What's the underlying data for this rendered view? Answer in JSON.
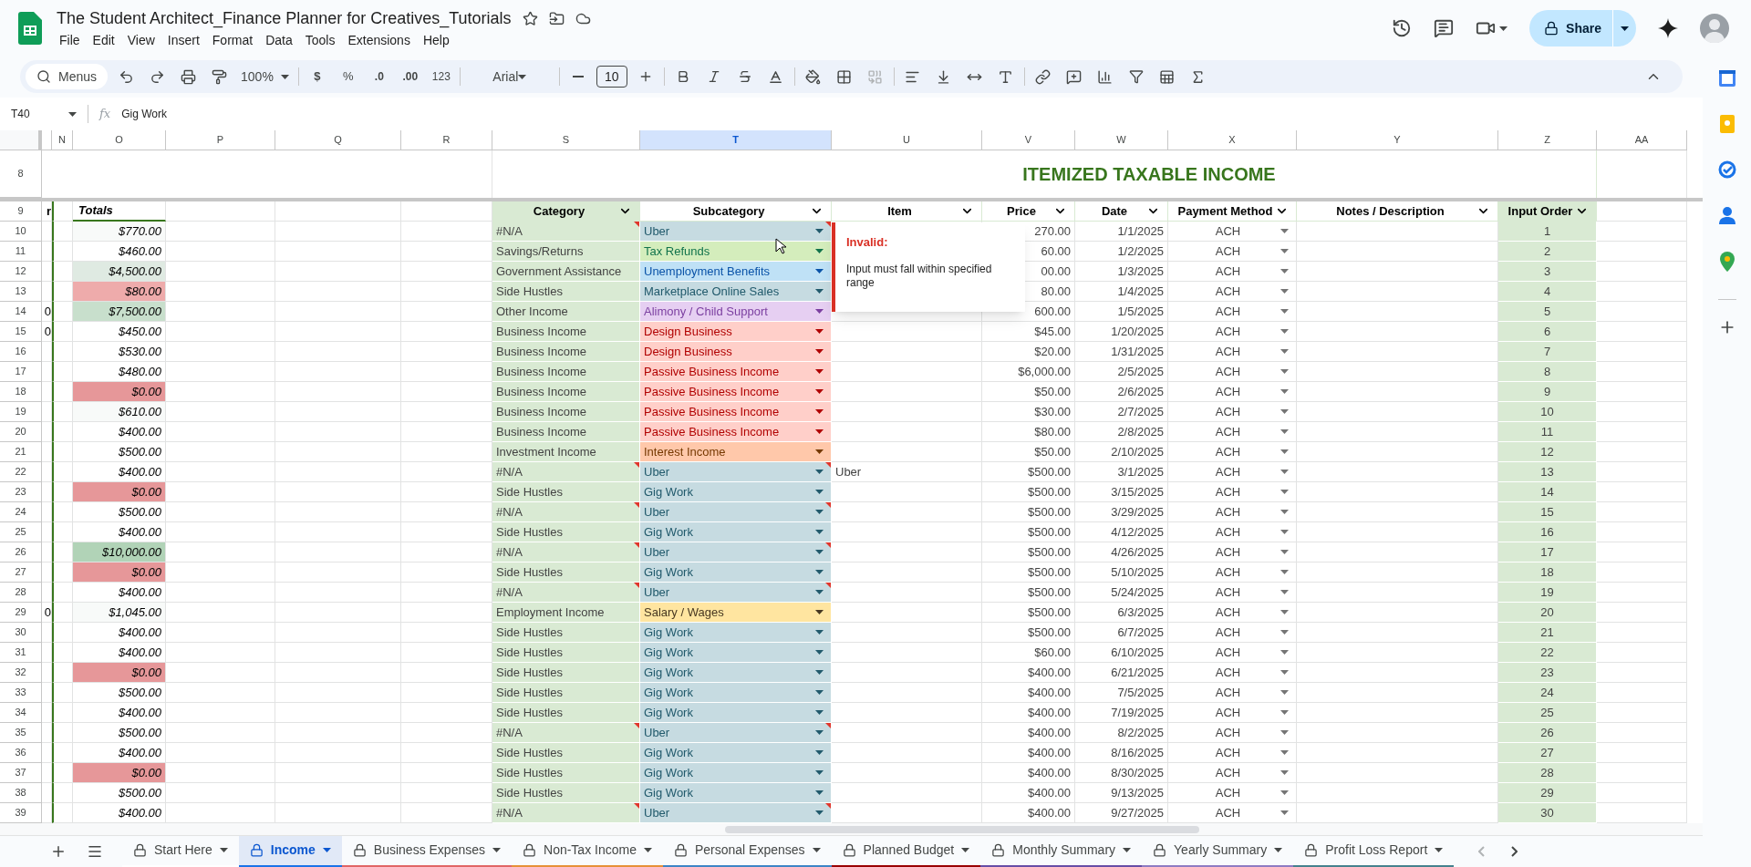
{
  "document": {
    "title": "The Student Architect_Finance Planner for Creatives_Tutorials",
    "menus": [
      "File",
      "Edit",
      "View",
      "Insert",
      "Format",
      "Data",
      "Tools",
      "Extensions",
      "Help"
    ],
    "share": "Share"
  },
  "toolbar": {
    "search": "Menus",
    "zoom": "100%",
    "currency": "$",
    "percent": "%",
    "decrease_decimals": ".0",
    "increase_decimals": ".00",
    "number_format": "123",
    "font": "Arial",
    "font_size": "10"
  },
  "formula_bar": {
    "cell": "T40",
    "fx_label": "fx",
    "value": "Gig Work"
  },
  "columns": [
    {
      "label": "N",
      "selected": false
    },
    {
      "label": "O",
      "selected": false
    },
    {
      "label": "P",
      "selected": false
    },
    {
      "label": "Q",
      "selected": false
    },
    {
      "label": "R",
      "selected": false
    },
    {
      "label": "S",
      "selected": false
    },
    {
      "label": "T",
      "selected": true
    },
    {
      "label": "U",
      "selected": false
    },
    {
      "label": "V",
      "selected": false
    },
    {
      "label": "W",
      "selected": false
    },
    {
      "label": "X",
      "selected": false
    },
    {
      "label": "Y",
      "selected": false
    },
    {
      "label": "Z",
      "selected": false
    },
    {
      "label": "AA",
      "selected": false
    }
  ],
  "title_row": {
    "number": "8",
    "title": "ITEMIZED TAXABLE INCOME"
  },
  "header_row": {
    "number": "9",
    "spill": "r",
    "totals_label": "Totals",
    "headers": [
      {
        "label": "Category",
        "shaded": true
      },
      {
        "label": "Subcategory",
        "shaded": false
      },
      {
        "label": "Item",
        "shaded": false
      },
      {
        "label": "Price",
        "shaded": false
      },
      {
        "label": "Date",
        "shaded": false
      },
      {
        "label": "Payment Method",
        "shaded": false
      },
      {
        "label": "Notes / Description",
        "shaded": false
      },
      {
        "label": "Input Order",
        "shaded": true
      }
    ]
  },
  "rows": [
    {
      "number": "10",
      "total": {
        "text": "$770.00",
        "color": "#f8faf9"
      },
      "category": "#N/A",
      "invalid": true,
      "subcategory": {
        "color": "#c6dbe1",
        "label": {
          "text": "Uber",
          "color": "#215a6c"
        }
      },
      "price": "270.00",
      "date": "1/1/2025",
      "payment": "ACH",
      "order": "1"
    },
    {
      "number": "11",
      "total": {
        "text": "$460.00"
      },
      "category": "Savings/Returns",
      "invalid": false,
      "subcategory": {
        "color": "#d4edbc",
        "label": {
          "text": "Tax Refunds",
          "color": "#11734b"
        }
      },
      "price": "60.00",
      "date": "1/2/2025",
      "payment": "ACH",
      "order": "2"
    },
    {
      "number": "12",
      "total": {
        "text": "$4,500.00",
        "color": "#dfeae2"
      },
      "category": "Government Assistance",
      "invalid": false,
      "subcategory": {
        "color": "#bfe1f6",
        "label": {
          "text": "Unemployment Benefits",
          "color": "#0a53a8"
        }
      },
      "price": "00.00",
      "date": "1/3/2025",
      "payment": "ACH",
      "order": "3"
    },
    {
      "number": "13",
      "total": {
        "text": "$80.00",
        "color": "#eeabab"
      },
      "category": "Side Hustles",
      "invalid": false,
      "subcategory": {
        "color": "#c6dbe1",
        "label": {
          "text": "Marketplace Online Sales",
          "color": "#215a6c"
        }
      },
      "price": "80.00",
      "date": "1/4/2025",
      "payment": "ACH",
      "order": "4"
    },
    {
      "number": "14",
      "spill": "0",
      "total": {
        "text": "$7,500.00",
        "color": "#c8dfcc"
      },
      "category": "Other Income",
      "invalid": false,
      "subcategory": {
        "color": "#e6cff2",
        "label": {
          "text": "Alimony / Child Support",
          "color": "#7b3fa0"
        }
      },
      "price": "600.00",
      "date": "1/5/2025",
      "payment": "ACH",
      "order": "5"
    },
    {
      "number": "15",
      "spill": "0",
      "total": {
        "text": "$450.00"
      },
      "category": "Business Income",
      "invalid": false,
      "subcategory": {
        "color": "#ffcfc9",
        "label": {
          "text": "Design Business",
          "color": "#b10202"
        }
      },
      "price": "$45.00",
      "date": "1/20/2025",
      "payment": "ACH",
      "order": "6"
    },
    {
      "number": "16",
      "total": {
        "text": "$530.00"
      },
      "category": "Business Income",
      "invalid": false,
      "subcategory": {
        "color": "#ffcfc9",
        "label": {
          "text": "Design Business",
          "color": "#b10202"
        }
      },
      "price": "$20.00",
      "date": "1/31/2025",
      "payment": "ACH",
      "order": "7"
    },
    {
      "number": "17",
      "total": {
        "text": "$480.00"
      },
      "category": "Business Income",
      "invalid": false,
      "subcategory": {
        "color": "#ffcfc9",
        "label": {
          "text": "Passive Business Income",
          "color": "#b10202"
        }
      },
      "price": "$6,000.00",
      "date": "2/5/2025",
      "payment": "ACH",
      "order": "8"
    },
    {
      "number": "18",
      "total": {
        "text": "$0.00",
        "color": "#e69799"
      },
      "category": "Business Income",
      "invalid": false,
      "subcategory": {
        "color": "#ffcfc9",
        "label": {
          "text": "Passive Business Income",
          "color": "#b10202"
        }
      },
      "price": "$50.00",
      "date": "2/6/2025",
      "payment": "ACH",
      "order": "9"
    },
    {
      "number": "19",
      "total": {
        "text": "$610.00",
        "color": "#f8faf9"
      },
      "category": "Business Income",
      "invalid": false,
      "subcategory": {
        "color": "#ffcfc9",
        "label": {
          "text": "Passive Business Income",
          "color": "#b10202"
        }
      },
      "price": "$30.00",
      "date": "2/7/2025",
      "payment": "ACH",
      "order": "10"
    },
    {
      "number": "20",
      "total": {
        "text": "$400.00"
      },
      "category": "Business Income",
      "invalid": false,
      "subcategory": {
        "color": "#ffcfc9",
        "label": {
          "text": "Passive Business Income",
          "color": "#b10202"
        }
      },
      "price": "$80.00",
      "date": "2/8/2025",
      "payment": "ACH",
      "order": "11"
    },
    {
      "number": "21",
      "total": {
        "text": "$500.00"
      },
      "category": "Investment Income",
      "invalid": false,
      "subcategory": {
        "color": "#ffc8aa",
        "label": {
          "text": "Interest Income",
          "color": "#753800"
        }
      },
      "price": "$50.00",
      "date": "2/10/2025",
      "payment": "ACH",
      "order": "12"
    },
    {
      "number": "22",
      "total": {
        "text": "$400.00"
      },
      "category": "#N/A",
      "invalid": true,
      "subcategory": {
        "color": "#c6dbe1",
        "label": {
          "text": "Uber",
          "color": "#215a6c"
        }
      },
      "item": "Uber",
      "price": "$500.00",
      "date": "3/1/2025",
      "payment": "ACH",
      "order": "13"
    },
    {
      "number": "23",
      "total": {
        "text": "$0.00",
        "color": "#e69799"
      },
      "category": "Side Hustles",
      "invalid": false,
      "subcategory": {
        "color": "#c6dbe1",
        "label": {
          "text": "Gig Work",
          "color": "#215a6c"
        }
      },
      "price": "$500.00",
      "date": "3/15/2025",
      "payment": "ACH",
      "order": "14"
    },
    {
      "number": "24",
      "total": {
        "text": "$500.00"
      },
      "category": "#N/A",
      "invalid": true,
      "subcategory": {
        "color": "#c6dbe1",
        "label": {
          "text": "Uber",
          "color": "#215a6c"
        }
      },
      "price": "$500.00",
      "date": "3/29/2025",
      "payment": "ACH",
      "order": "15"
    },
    {
      "number": "25",
      "total": {
        "text": "$400.00"
      },
      "category": "Side Hustles",
      "invalid": false,
      "subcategory": {
        "color": "#c6dbe1",
        "label": {
          "text": "Gig Work",
          "color": "#215a6c"
        }
      },
      "price": "$500.00",
      "date": "4/12/2025",
      "payment": "ACH",
      "order": "16"
    },
    {
      "number": "26",
      "total": {
        "text": "$10,000.00",
        "color": "#b1d3b7"
      },
      "category": "#N/A",
      "invalid": true,
      "subcategory": {
        "color": "#c6dbe1",
        "label": {
          "text": "Uber",
          "color": "#215a6c"
        }
      },
      "price": "$500.00",
      "date": "4/26/2025",
      "payment": "ACH",
      "order": "17"
    },
    {
      "number": "27",
      "total": {
        "text": "$0.00",
        "color": "#e69799"
      },
      "category": "Side Hustles",
      "invalid": false,
      "subcategory": {
        "color": "#c6dbe1",
        "label": {
          "text": "Gig Work",
          "color": "#215a6c"
        }
      },
      "price": "$500.00",
      "date": "5/10/2025",
      "payment": "ACH",
      "order": "18"
    },
    {
      "number": "28",
      "total": {
        "text": "$400.00"
      },
      "category": "#N/A",
      "invalid": true,
      "subcategory": {
        "color": "#c6dbe1",
        "label": {
          "text": "Uber",
          "color": "#215a6c"
        }
      },
      "price": "$500.00",
      "date": "5/24/2025",
      "payment": "ACH",
      "order": "19"
    },
    {
      "number": "29",
      "spill": "0",
      "total": {
        "text": "$1,045.00",
        "color": "#f8faf9"
      },
      "category": "Employment Income",
      "invalid": false,
      "subcategory": {
        "color": "#ffe5a0",
        "label": {
          "text": "Salary / Wages",
          "color": "#473821"
        }
      },
      "price": "$500.00",
      "date": "6/3/2025",
      "payment": "ACH",
      "order": "20"
    },
    {
      "number": "30",
      "total": {
        "text": "$400.00"
      },
      "category": "Side Hustles",
      "invalid": false,
      "subcategory": {
        "color": "#c6dbe1",
        "label": {
          "text": "Gig Work",
          "color": "#215a6c"
        }
      },
      "price": "$500.00",
      "date": "6/7/2025",
      "payment": "ACH",
      "order": "21"
    },
    {
      "number": "31",
      "total": {
        "text": "$400.00"
      },
      "category": "Side Hustles",
      "invalid": false,
      "subcategory": {
        "color": "#c6dbe1",
        "label": {
          "text": "Gig Work",
          "color": "#215a6c"
        }
      },
      "price": "$60.00",
      "date": "6/10/2025",
      "payment": "ACH",
      "order": "22"
    },
    {
      "number": "32",
      "total": {
        "text": "$0.00",
        "color": "#e69799"
      },
      "category": "Side Hustles",
      "invalid": false,
      "subcategory": {
        "color": "#c6dbe1",
        "label": {
          "text": "Gig Work",
          "color": "#215a6c"
        }
      },
      "price": "$400.00",
      "date": "6/21/2025",
      "payment": "ACH",
      "order": "23"
    },
    {
      "number": "33",
      "total": {
        "text": "$500.00"
      },
      "category": "Side Hustles",
      "invalid": false,
      "subcategory": {
        "color": "#c6dbe1",
        "label": {
          "text": "Gig Work",
          "color": "#215a6c"
        }
      },
      "price": "$400.00",
      "date": "7/5/2025",
      "payment": "ACH",
      "order": "24"
    },
    {
      "number": "34",
      "total": {
        "text": "$400.00"
      },
      "category": "Side Hustles",
      "invalid": false,
      "subcategory": {
        "color": "#c6dbe1",
        "label": {
          "text": "Gig Work",
          "color": "#215a6c"
        }
      },
      "price": "$400.00",
      "date": "7/19/2025",
      "payment": "ACH",
      "order": "25"
    },
    {
      "number": "35",
      "total": {
        "text": "$500.00"
      },
      "category": "#N/A",
      "invalid": true,
      "subcategory": {
        "color": "#c6dbe1",
        "label": {
          "text": "Uber",
          "color": "#215a6c"
        }
      },
      "price": "$400.00",
      "date": "8/2/2025",
      "payment": "ACH",
      "order": "26"
    },
    {
      "number": "36",
      "total": {
        "text": "$400.00"
      },
      "category": "Side Hustles",
      "invalid": false,
      "subcategory": {
        "color": "#c6dbe1",
        "label": {
          "text": "Gig Work",
          "color": "#215a6c"
        }
      },
      "price": "$400.00",
      "date": "8/16/2025",
      "payment": "ACH",
      "order": "27"
    },
    {
      "number": "37",
      "total": {
        "text": "$0.00",
        "color": "#e69799"
      },
      "category": "Side Hustles",
      "invalid": false,
      "subcategory": {
        "color": "#c6dbe1",
        "label": {
          "text": "Gig Work",
          "color": "#215a6c"
        }
      },
      "price": "$400.00",
      "date": "8/30/2025",
      "payment": "ACH",
      "order": "28"
    },
    {
      "number": "38",
      "total": {
        "text": "$500.00"
      },
      "category": "Side Hustles",
      "invalid": false,
      "subcategory": {
        "color": "#c6dbe1",
        "label": {
          "text": "Gig Work",
          "color": "#215a6c"
        }
      },
      "price": "$400.00",
      "date": "9/13/2025",
      "payment": "ACH",
      "order": "29"
    },
    {
      "number": "39",
      "total": {
        "text": "$400.00"
      },
      "category": "#N/A",
      "invalid": true,
      "subcategory": {
        "color": "#c6dbe1",
        "label": {
          "text": "Uber",
          "color": "#215a6c"
        }
      },
      "price": "$400.00",
      "date": "9/27/2025",
      "payment": "ACH",
      "order": "30"
    }
  ],
  "validation_tooltip": {
    "title": "Invalid:",
    "message": "Input must fall within specified range"
  },
  "sheet_tabs": [
    {
      "label": "Start Here",
      "selected": false,
      "color": "#ffffff"
    },
    {
      "label": "Income",
      "selected": true,
      "color": "#1a73e8"
    },
    {
      "label": "Business Expenses",
      "selected": false,
      "color": "#e06666"
    },
    {
      "label": "Non-Tax Income",
      "selected": false,
      "color": "#e69138"
    },
    {
      "label": "Personal Expenses",
      "selected": false,
      "color": "#3d85c6"
    },
    {
      "label": "Planned Budget",
      "selected": false,
      "color": "#990000"
    },
    {
      "label": "Monthly Summary",
      "selected": false,
      "color": "#674ea7"
    },
    {
      "label": "Yearly Summary",
      "selected": false,
      "color": "#8e7cc3"
    },
    {
      "label": "Profit Loss Report",
      "selected": false,
      "color": "#45818e"
    }
  ]
}
